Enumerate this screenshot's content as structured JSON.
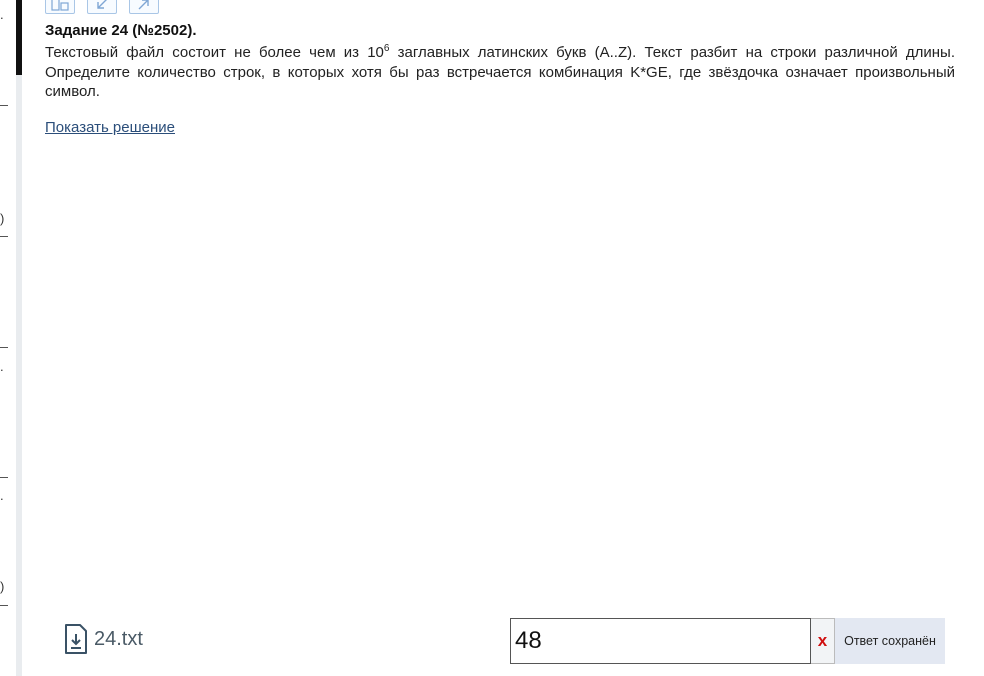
{
  "edge_marks": [
    ".",
    ")",
    ".",
    ".",
    ")"
  ],
  "task": {
    "title": "Задание 24 (№2502).",
    "text_before_sup": "Текстовый файл состоит не более чем из 10",
    "sup": "6",
    "text_after_sup": " заглавных латинских букв (A..Z). Текст разбит на строки различной длины. Определите количество строк, в которых хотя бы раз встречается комбинация K*GE, где звёздочка означает произвольный символ."
  },
  "show_solution_label": "Показать решение",
  "file": {
    "name": "24.txt",
    "icon": "download-file-icon"
  },
  "answer": {
    "value": "48",
    "clear_label": "x",
    "status": "Ответ сохранён"
  },
  "colors": {
    "link": "#2b4e7a",
    "clear": "#d01010",
    "status_bg": "#e3e8f2"
  }
}
